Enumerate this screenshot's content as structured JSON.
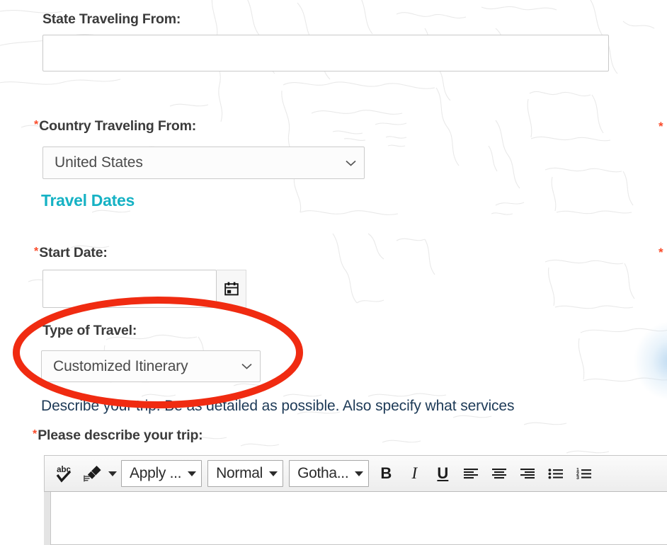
{
  "page": {
    "background_map": "world-map-outline",
    "map_stroke_color": "#e9e9e9",
    "accent_teal": "#16b2c4",
    "required_marker_color": "#fa4b2a",
    "helper_text_color": "#1d3a57",
    "annotation_color": "#f02b11"
  },
  "form": {
    "state_field": {
      "label": "State Traveling From:",
      "required": false,
      "value": "",
      "placeholder": ""
    },
    "country_field": {
      "label": "Country Traveling From:",
      "required": true,
      "required_marker": "*",
      "value": "United States",
      "chevron": "chevron-down-icon"
    },
    "travel_dates_heading": "Travel Dates",
    "start_date_field": {
      "label": "Start Date:",
      "required": true,
      "required_marker": "*",
      "value": "",
      "calendar_icon": "calendar-icon"
    },
    "type_of_travel_field": {
      "label": "Type of Travel:",
      "required": false,
      "value": "Customized Itinerary",
      "chevron": "chevron-down-icon"
    },
    "describe_helper": "Describe your trip. Be as detailed as possible. Also specify what services",
    "describe_field": {
      "label": "Please describe your trip:",
      "required": true,
      "required_marker": "*",
      "value": ""
    },
    "stray_required_markers": [
      "*",
      "*"
    ]
  },
  "editor": {
    "toolbar": {
      "spellcheck_label": "abc",
      "spellcheck_icon": "spellcheck-abc-icon",
      "format_painter_icon": "format-painter-icon",
      "format_painter_caret": "caret-down-icon",
      "style_select": {
        "value": "Apply ...",
        "caret": "caret-down-icon"
      },
      "format_select": {
        "value": "Normal",
        "caret": "caret-down-icon"
      },
      "font_select": {
        "value": "Gotha...",
        "caret": "caret-down-icon"
      },
      "bold_label": "B",
      "italic_label": "I",
      "underline_label": "U",
      "align_left_icon": "align-left-icon",
      "align_center_icon": "align-center-icon",
      "align_right_icon": "align-right-icon",
      "bullet_list_icon": "bulleted-list-icon",
      "numbered_list_icon": "numbered-list-icon"
    },
    "body_value": ""
  }
}
